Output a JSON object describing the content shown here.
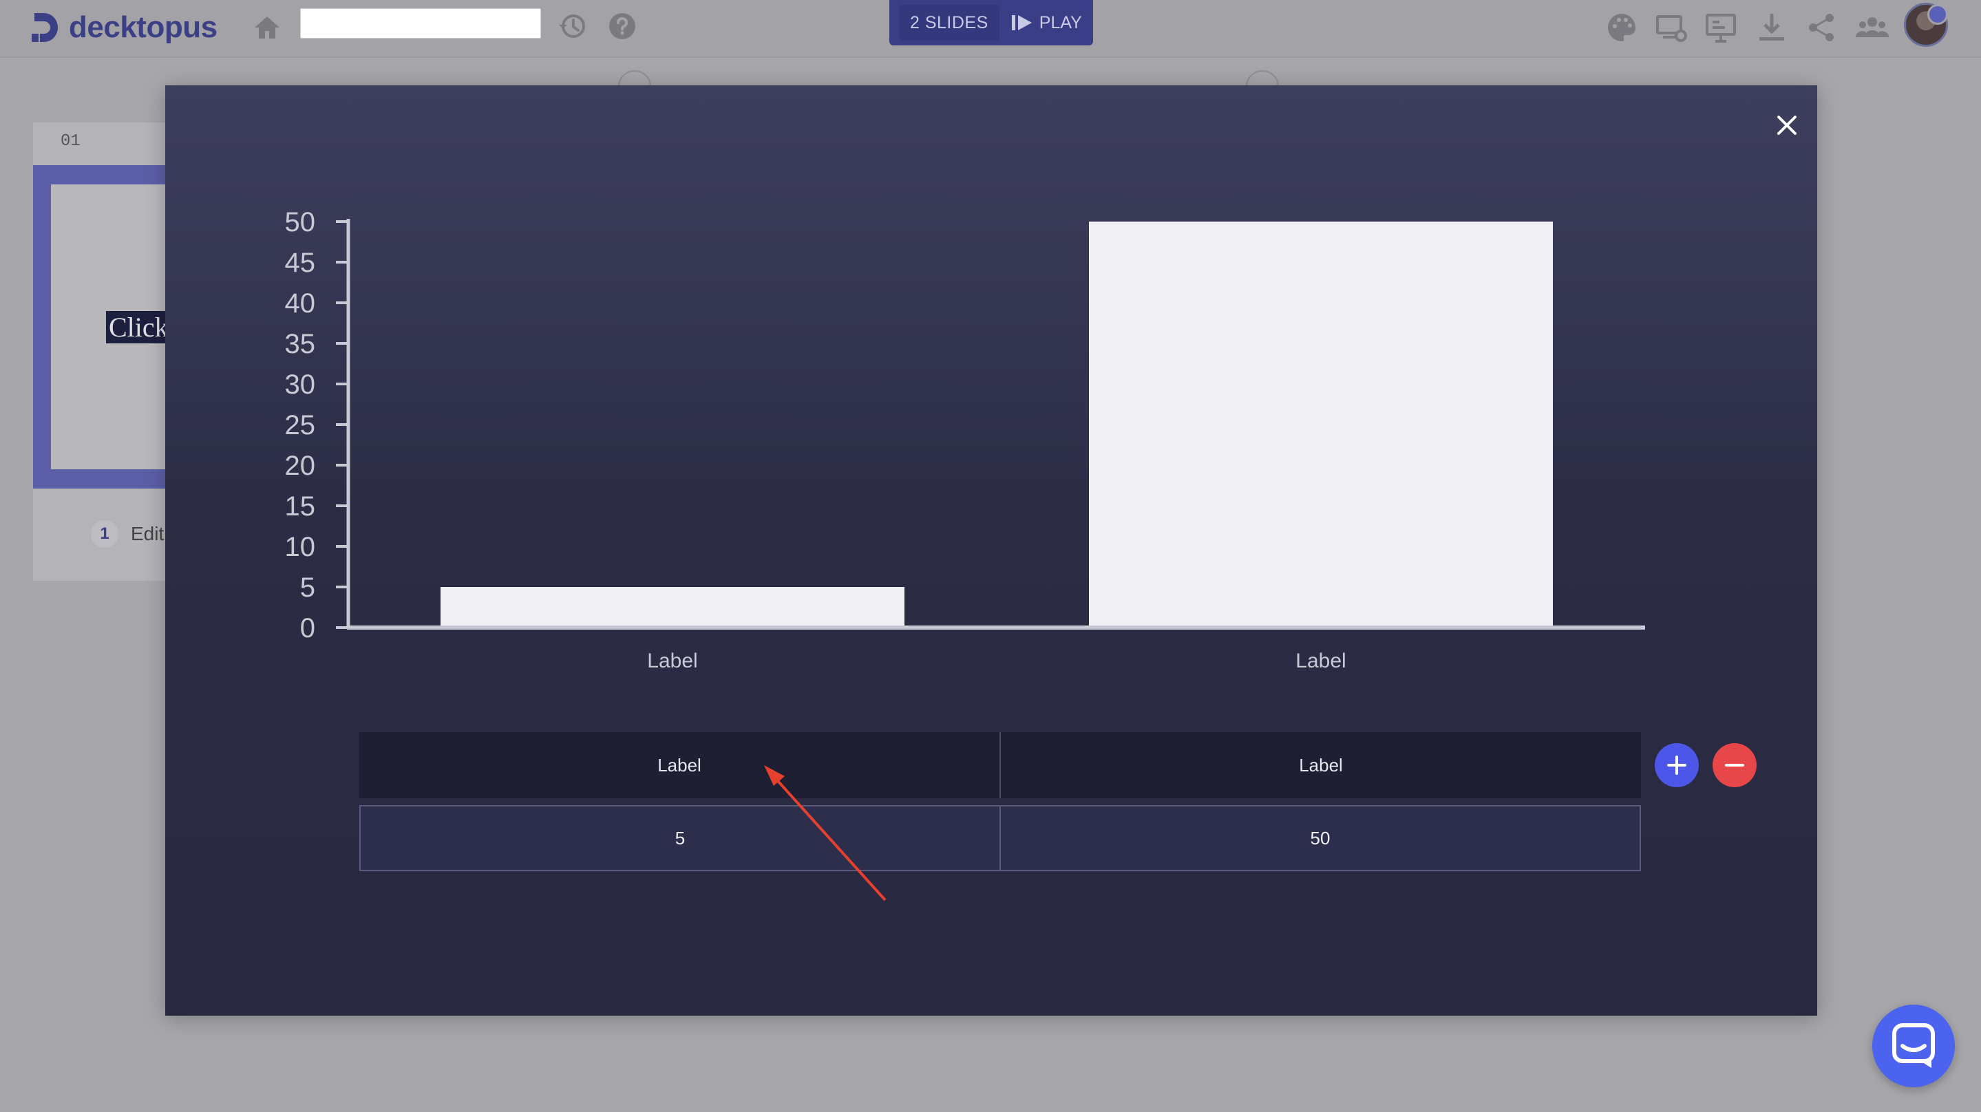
{
  "app": {
    "logo_text": "decktopus",
    "title_value": "",
    "slides_count": "2 SLIDES",
    "play_label": "PLAY"
  },
  "toolbar_icons": [
    "palette-icon",
    "device-settings-icon",
    "presenter-icon",
    "download-icon",
    "share-icon",
    "team-icon"
  ],
  "editor_background": {
    "thumbnail_number": "01",
    "thumbnail_text": "Click",
    "page_badge": "1",
    "edit_label": "Edit"
  },
  "modal": {
    "close_icon": "close-icon",
    "columns": [
      {
        "label": "Label",
        "value": "5"
      },
      {
        "label": "Label",
        "value": "50"
      }
    ],
    "add_icon": "plus-icon",
    "remove_icon": "minus-icon",
    "colors": {
      "bar": "#f0f0f5",
      "axis": "#c9c9d6",
      "add_button": "#4c56e8",
      "remove_button": "#e8474a",
      "annotation_arrow": "#e5412e"
    }
  },
  "chart_data": {
    "type": "bar",
    "categories": [
      "Label",
      "Label"
    ],
    "values": [
      5,
      50
    ],
    "ylim": [
      0,
      50
    ],
    "yticks": [
      0,
      5,
      10,
      15,
      20,
      25,
      30,
      35,
      40,
      45,
      50
    ],
    "grid": false,
    "title": "",
    "xlabel": "",
    "ylabel": ""
  }
}
